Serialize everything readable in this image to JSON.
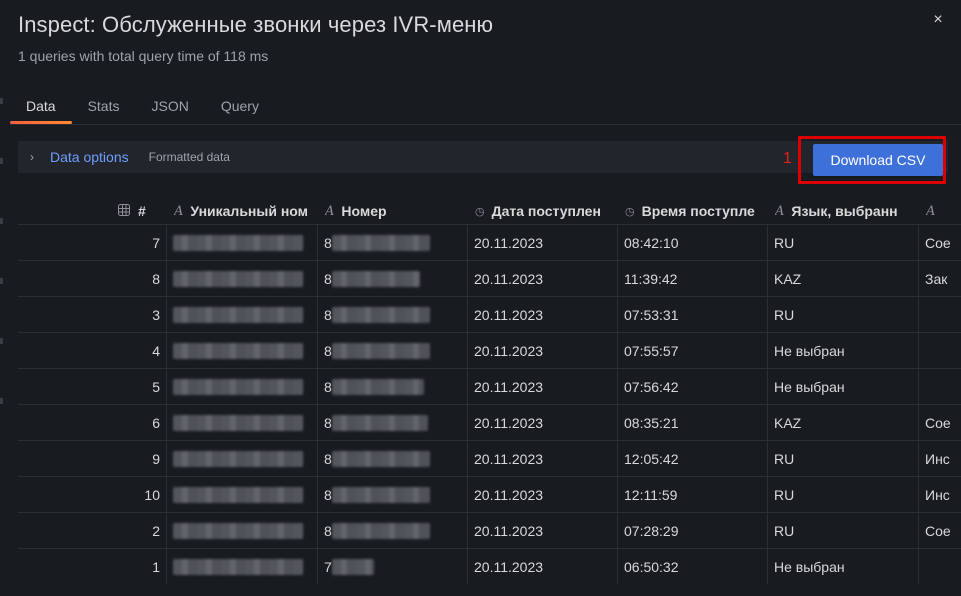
{
  "modal": {
    "title": "Inspect: Обслуженные звонки через IVR-меню",
    "subtitle": "1 queries with total query time of 118 ms",
    "close_icon": "×"
  },
  "tabs": [
    {
      "label": "Data",
      "active": true
    },
    {
      "label": "Stats",
      "active": false
    },
    {
      "label": "JSON",
      "active": false
    },
    {
      "label": "Query",
      "active": false
    }
  ],
  "options": {
    "chevron": "›",
    "label": "Data options",
    "description": "Formatted data"
  },
  "annotation": {
    "number": "1"
  },
  "download_label": "Download CSV",
  "table": {
    "columns": [
      {
        "icon": "table-icon",
        "label": "#"
      },
      {
        "icon": "text-type-icon",
        "label": "Уникальный ном"
      },
      {
        "icon": "text-type-icon",
        "label": "Номер"
      },
      {
        "icon": "clock-icon",
        "label": "Дата поступлен"
      },
      {
        "icon": "clock-icon",
        "label": "Время поступле"
      },
      {
        "icon": "text-type-icon",
        "label": "Язык, выбранн"
      },
      {
        "icon": "text-type-icon",
        "label": ""
      }
    ],
    "rows": [
      {
        "n": "7",
        "num_prefix": "8",
        "date": "20.11.2023",
        "time": "08:42:10",
        "lang": "RU",
        "extra": "Сое"
      },
      {
        "n": "8",
        "num_prefix": "8",
        "date": "20.11.2023",
        "time": "11:39:42",
        "lang": "KAZ",
        "extra": "Зак"
      },
      {
        "n": "3",
        "num_prefix": "8",
        "date": "20.11.2023",
        "time": "07:53:31",
        "lang": "RU",
        "extra": ""
      },
      {
        "n": "4",
        "num_prefix": "8",
        "date": "20.11.2023",
        "time": "07:55:57",
        "lang": "Не выбран",
        "extra": ""
      },
      {
        "n": "5",
        "num_prefix": "8",
        "date": "20.11.2023",
        "time": "07:56:42",
        "lang": "Не выбран",
        "extra": ""
      },
      {
        "n": "6",
        "num_prefix": "8",
        "date": "20.11.2023",
        "time": "08:35:21",
        "lang": "KAZ",
        "extra": "Сое"
      },
      {
        "n": "9",
        "num_prefix": "8",
        "date": "20.11.2023",
        "time": "12:05:42",
        "lang": "RU",
        "extra": "Инс"
      },
      {
        "n": "10",
        "num_prefix": "8",
        "date": "20.11.2023",
        "time": "12:11:59",
        "lang": "RU",
        "extra": "Инс"
      },
      {
        "n": "2",
        "num_prefix": "8",
        "date": "20.11.2023",
        "time": "07:28:29",
        "lang": "RU",
        "extra": "Сое"
      },
      {
        "n": "1",
        "num_prefix": "7",
        "date": "20.11.2023",
        "time": "06:50:32",
        "lang": "Не выбран",
        "extra": ""
      }
    ]
  }
}
